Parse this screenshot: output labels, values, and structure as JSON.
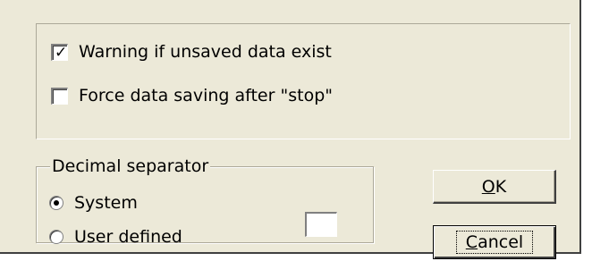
{
  "options": {
    "warning_unsaved": {
      "label": "Warning if unsaved data exist",
      "checked": true
    },
    "force_saving": {
      "label": "Force data saving after \"stop\"",
      "checked": false
    }
  },
  "decimal_separator": {
    "legend": "Decimal separator",
    "options": [
      {
        "label": "System",
        "selected": true
      },
      {
        "label": "User defined",
        "selected": false
      }
    ],
    "custom_value": ""
  },
  "buttons": {
    "ok": {
      "mnemonic": "O",
      "rest": "K"
    },
    "cancel": {
      "mnemonic": "C",
      "rest": "ancel"
    }
  },
  "colors": {
    "dialog_bg": "#ece9d8",
    "shadow": "#404040",
    "highlight": "#ffffff"
  }
}
